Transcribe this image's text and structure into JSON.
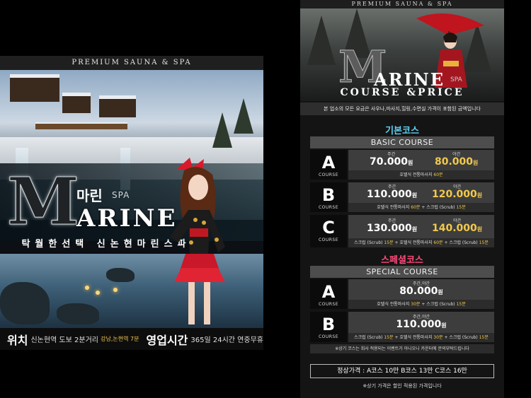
{
  "left_poster": {
    "top_banner": "PREMIUM SAUNA & SPA",
    "logo_letter": "M",
    "logo_korean": "마린",
    "logo_spa": "SPA",
    "logo_rest": "ARINE",
    "slogan": "탁월한선택 신논현마린스파",
    "location_label": "위치",
    "location_text": "신논현역 도보 2분거리",
    "location_exit": "강남,논현역 7분",
    "hours_label": "영업시간",
    "hours_text": "365일 24시간 연중무휴"
  },
  "right_poster": {
    "top_banner": "PREMIUM SAUNA & SPA",
    "logo_letter": "M",
    "logo_rest": "ARINE",
    "logo_spa": "SPA",
    "subtitle": "COURSE &PRICE",
    "notice": "본 업소의 모든 요금은 사우나,마사지,힐링,수면실 가격이 포함된 금액입니다",
    "basic": {
      "title_kr": "기본코스",
      "title_en": "BASIC COURSE",
      "title_color": "#5fd1f0",
      "courses": [
        {
          "letter": "A",
          "label": "COURSE",
          "day_label": "주간",
          "day_price": "70.000",
          "night_label": "야간",
          "night_price": "80.000",
          "won": "원",
          "desc_plain": "호텔식 전통마사지",
          "desc_hl": "60분",
          "desc_plain2": "",
          "desc_hl2": ""
        },
        {
          "letter": "B",
          "label": "COURSE",
          "day_label": "주간",
          "day_price": "110.000",
          "night_label": "야간",
          "night_price": "120.000",
          "won": "원",
          "desc_plain": "호텔식 전통마사지",
          "desc_hl": "60분",
          "desc_plain2": "+ 스크럽 (Scrub)",
          "desc_hl2": "15분"
        },
        {
          "letter": "C",
          "label": "COURSE",
          "day_label": "주간",
          "day_price": "130.000",
          "night_label": "야간",
          "night_price": "140.000",
          "won": "원",
          "desc_plain": "스크럽 (Scrub)",
          "desc_hl": "15분",
          "desc_plain2": "+ 호텔식 전통마사지",
          "desc_hl2": "60분",
          "desc_plain3": "+ 스크럽 (Scrub)",
          "desc_hl3": "15분"
        }
      ]
    },
    "special": {
      "title_kr": "스페셜코스",
      "title_en": "SPECIAL COURSE",
      "title_color": "#ff4a7a",
      "courses": [
        {
          "letter": "A",
          "label": "COURSE",
          "price_label": "주간,야간",
          "price": "80.000",
          "won": "원",
          "desc_plain": "호텔식 전통마사지",
          "desc_hl": "30분",
          "desc_plain2": "+ 스크럽 (Scrub)",
          "desc_hl2": "15분"
        },
        {
          "letter": "B",
          "label": "COURSE",
          "price_label": "주간,야간",
          "price": "110.000",
          "won": "원",
          "desc_plain": "스크럽 (Scrub)",
          "desc_hl": "15분",
          "desc_plain2": "+ 호텔식 전통마사지",
          "desc_hl2": "30분",
          "desc_plain3": "+ 스크럽 (Scrub)",
          "desc_hl3": "15분"
        }
      ],
      "note": "※상기 코스는 회사 적용되는 이벤트가 아니오니 카운터에 문의부탁드립니다"
    },
    "regular_price": "정상가격 : A코스 10만 B코스 13만 C코스 16만",
    "footnote": "※상기 가격은 할인 적용된 가격입니다"
  }
}
